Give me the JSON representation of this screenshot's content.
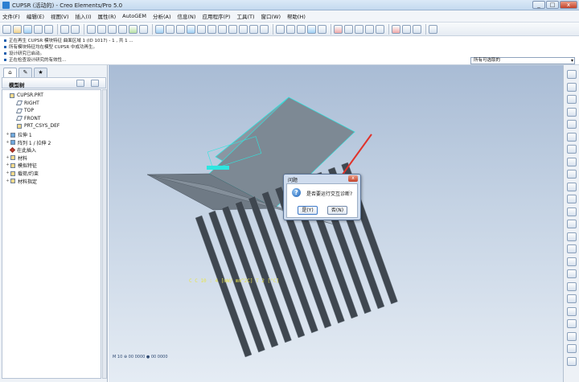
{
  "window": {
    "title": "CUPSR (活动的) - Creo Elements/Pro 5.0",
    "controls": [
      "_",
      "□",
      "x"
    ]
  },
  "menu": [
    "文件(F)",
    "编辑(E)",
    "视图(V)",
    "插入(I)",
    "属性(R)",
    "AutoGEM",
    "分析(A)",
    "信息(N)",
    "应用程序(P)",
    "工具(T)",
    "窗口(W)",
    "帮助(H)"
  ],
  "messages": [
    "正在再生 CUPSR 模块特征 曲面区域 1 (ID 1017) - 1 , 共 1 ...",
    "所有模块特征均在模型 CUPSR 中成功再生。",
    "设计研究已启动。",
    "正在检查设计研究的有效性..."
  ],
  "filter": {
    "value": "所有可选取的",
    "arrow": "▾"
  },
  "panel": {
    "tab_icons": [
      "⌂",
      "✎",
      "★"
    ],
    "title": "模型树",
    "nodes": [
      {
        "label": "CUPSR.PRT",
        "icon": "part-icon",
        "expand": ""
      },
      {
        "label": "RIGHT",
        "icon": "datum-plane-icon",
        "expand": ""
      },
      {
        "label": "TOP",
        "icon": "datum-plane-icon",
        "expand": ""
      },
      {
        "label": "FRONT",
        "icon": "datum-plane-icon",
        "expand": ""
      },
      {
        "label": "PRT_CSYS_DEF",
        "icon": "csys-icon",
        "expand": ""
      },
      {
        "label": "拉伸 1",
        "icon": "extrude-icon",
        "expand": "+"
      },
      {
        "label": "阵列 1 / 拉伸 2",
        "icon": "pattern-icon",
        "expand": "+"
      },
      {
        "label": "在此插入",
        "icon": "insert-here-icon",
        "expand": ""
      },
      {
        "label": "材料",
        "icon": "material-icon",
        "expand": "+"
      },
      {
        "label": "模拟特征",
        "icon": "simulation-feature-icon",
        "expand": "+"
      },
      {
        "label": "载荷/约束",
        "icon": "load-constraint-icon",
        "expand": "+"
      },
      {
        "label": "材料指定",
        "icon": "material-assign-icon",
        "expand": "+"
      }
    ]
  },
  "dialog": {
    "title": "问题",
    "question": "是否要运行交互诊断?",
    "yes_label": "是(Y)",
    "no_label": "否(N)",
    "close": "x",
    "question_mark": "?"
  },
  "annotation_text": "C C 10 : 4 [mW/  mm^2C]  T  2 [°C]",
  "status_text": "M    10          ⊕ 00 0000      ● 00 0000",
  "colors": {
    "model_top": "#7a8590",
    "model_edge": "#4b5560",
    "highlight": "#2ee6e0",
    "arrow": "#e0322a",
    "background_top": "#a9bcd5"
  }
}
